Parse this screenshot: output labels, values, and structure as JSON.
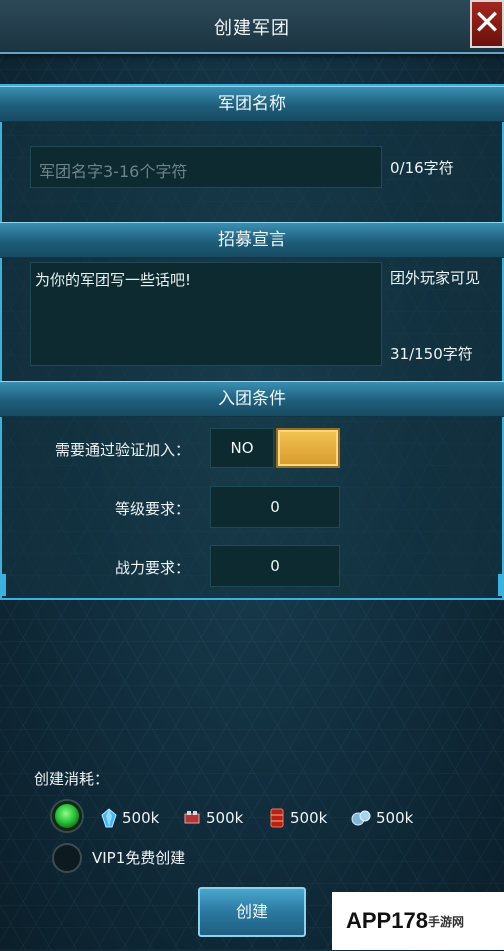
{
  "header": {
    "title": "创建军团",
    "close_icon": "close-icon"
  },
  "name_section": {
    "title": "军团名称",
    "placeholder": "军团名字3-16个字符",
    "counter": "0/16字符"
  },
  "recruit_section": {
    "title": "招募宣言",
    "text": "为你的军团写一些话吧!",
    "visibility_note": "团外玩家可见",
    "counter": "31/150字符"
  },
  "conditions_section": {
    "title": "入团条件",
    "verify_label": "需要通过验证加入：",
    "verify_value": "NO",
    "level_label": "等级要求：",
    "level_value": "0",
    "power_label": "战力要求：",
    "power_value": "0"
  },
  "cost": {
    "label": "创建消耗：",
    "options": [
      {
        "selected": true
      },
      {
        "selected": false,
        "label": "VIP1免费创建"
      }
    ],
    "resources": [
      {
        "icon": "crystal-icon",
        "amount": "500k"
      },
      {
        "icon": "gear-icon",
        "amount": "500k"
      },
      {
        "icon": "fuel-barrel-icon",
        "amount": "500k"
      },
      {
        "icon": "metal-icon",
        "amount": "500k"
      }
    ]
  },
  "create_button": "创建",
  "watermark": {
    "text": "APP178",
    "sub": "手游网"
  },
  "colors": {
    "accent": "#3bb1df",
    "toggle": "#e8b23e",
    "close": "#8f1e16",
    "radio_on": "#2bc43a"
  }
}
